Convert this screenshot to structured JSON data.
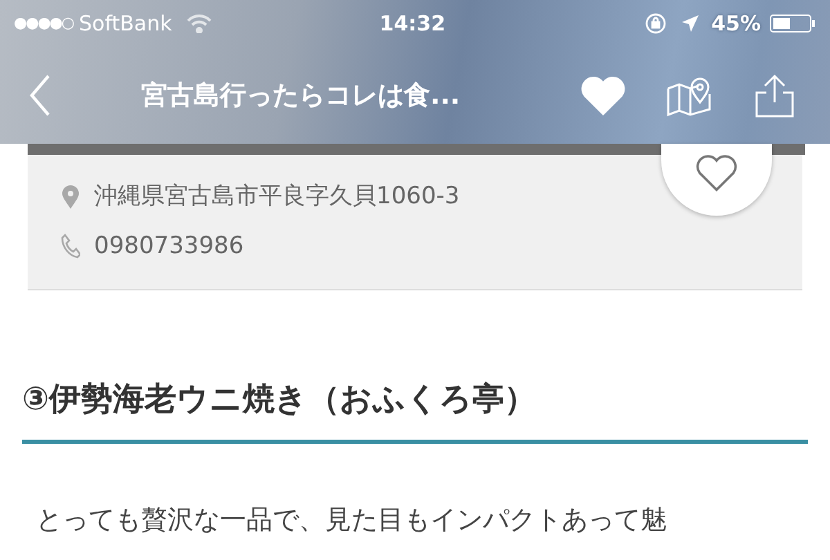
{
  "status_bar": {
    "signal": "●●●●○",
    "carrier": "SoftBank",
    "time": "14:32",
    "battery": "45%"
  },
  "nav": {
    "title": "宮古島行ったらコレは食..."
  },
  "shop_card": {
    "address": "沖縄県宮古島市平良字久貝1060-3",
    "phone": "0980733986"
  },
  "section": {
    "heading": "③伊勢海老ウニ焼き（おふくろ亭）",
    "paragraph": "とっても贅沢な一品で、見た目もインパクトあって魅"
  }
}
